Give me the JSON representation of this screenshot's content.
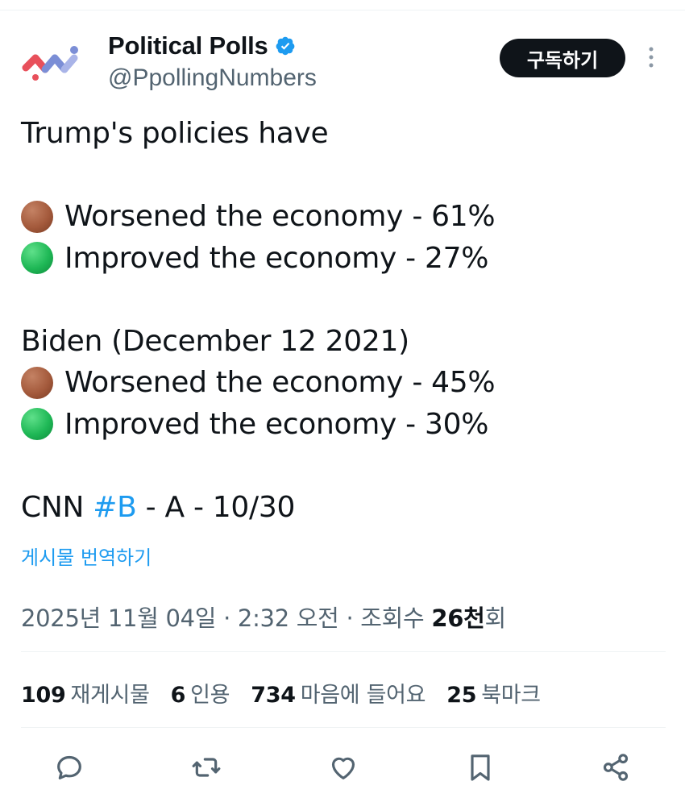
{
  "author": {
    "display_name": "Political Polls",
    "handle": "@PpollingNumbers",
    "verified": true
  },
  "subscribe_label": "구독하기",
  "tweet": {
    "line1": "Trump's policies have",
    "trump_worsened": "Worsened the economy - 61%",
    "trump_improved": "Improved the economy - 27%",
    "biden_header": "Biden (December 12 2021)",
    "biden_worsened": "Worsened the economy - 45%",
    "biden_improved": "Improved the economy - 30%",
    "source_prefix": "CNN ",
    "source_hashtag": "#B",
    "source_suffix": " - A - 10/30"
  },
  "translate_label": "게시물 번역하기",
  "meta": {
    "timestamp": "2025년 11월 04일 · 2:32 오전 · 조회수 ",
    "views": "26천",
    "views_suffix": "회"
  },
  "stats": {
    "reposts": {
      "num": "109",
      "label": "재게시물"
    },
    "quotes": {
      "num": "6",
      "label": "인용"
    },
    "likes": {
      "num": "734",
      "label": "마음에 들어요"
    },
    "bookmarks": {
      "num": "25",
      "label": "북마크"
    }
  },
  "icons": {
    "emoji_worse": "brown-circle",
    "emoji_better": "green-circle",
    "actions": [
      "reply-icon",
      "repost-icon",
      "like-icon",
      "bookmark-icon",
      "share-icon"
    ]
  },
  "colors": {
    "accent": "#1d9bf0",
    "text": "#0f1419",
    "muted": "#536471"
  }
}
